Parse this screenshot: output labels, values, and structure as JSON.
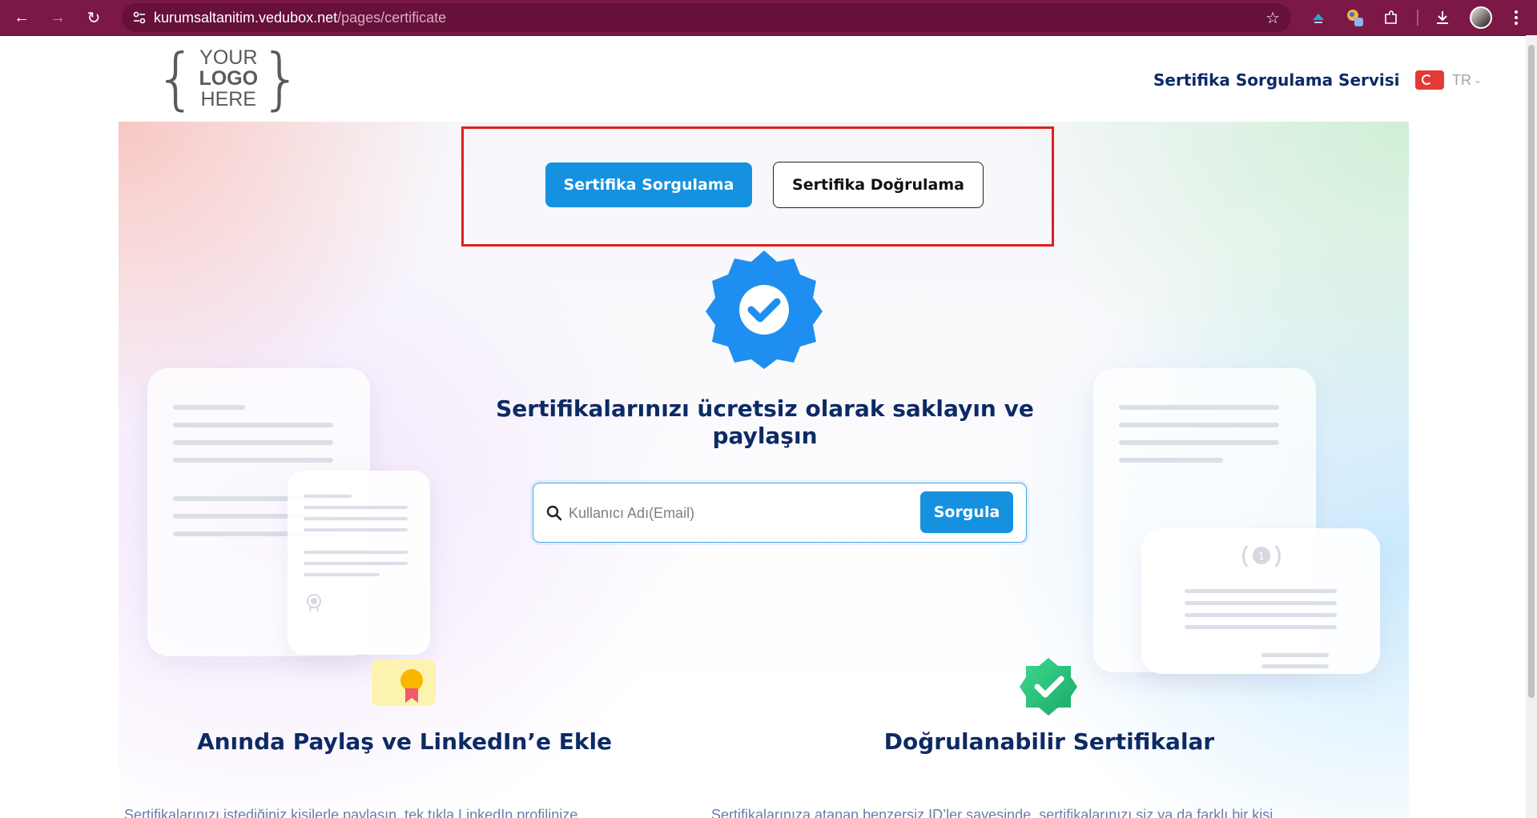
{
  "browser": {
    "url_host": "kurumsaltanitim.vedubox.net",
    "url_path": "/pages/certificate"
  },
  "logo": {
    "line1": "YOUR",
    "line2": "LOGO",
    "line3": "HERE"
  },
  "header": {
    "service_link": "Sertifika Sorgulama Servisi",
    "language": "TR"
  },
  "tabs": {
    "primary_label": "Sertifika Sorgulama",
    "secondary_label": "Sertifika Doğrulama"
  },
  "hero": {
    "headline_line1": "Sertifikalarınızı ücretsiz olarak saklayın ve",
    "headline_line2": "paylaşın"
  },
  "search": {
    "placeholder": "Kullanıcı Adı(Email)",
    "button_label": "Sorgula"
  },
  "features": [
    {
      "title": "Anında Paylaş ve LinkedIn’e Ekle",
      "body": "Sertifikalarınızı istediğiniz kişilerle paylaşın, tek tıkla LinkedIn profilinize"
    },
    {
      "title": "Doğrulanabilir Sertifikalar",
      "body": "Sertifikalarınıza atanan benzersiz ID’ler sayesinde, sertifikalarınızı siz ya da farklı bir kişi"
    }
  ],
  "colors": {
    "chrome": "#7c1846",
    "accent_blue": "#1591df",
    "heading_navy": "#0d2a66",
    "highlight_red": "#e01e1e"
  }
}
